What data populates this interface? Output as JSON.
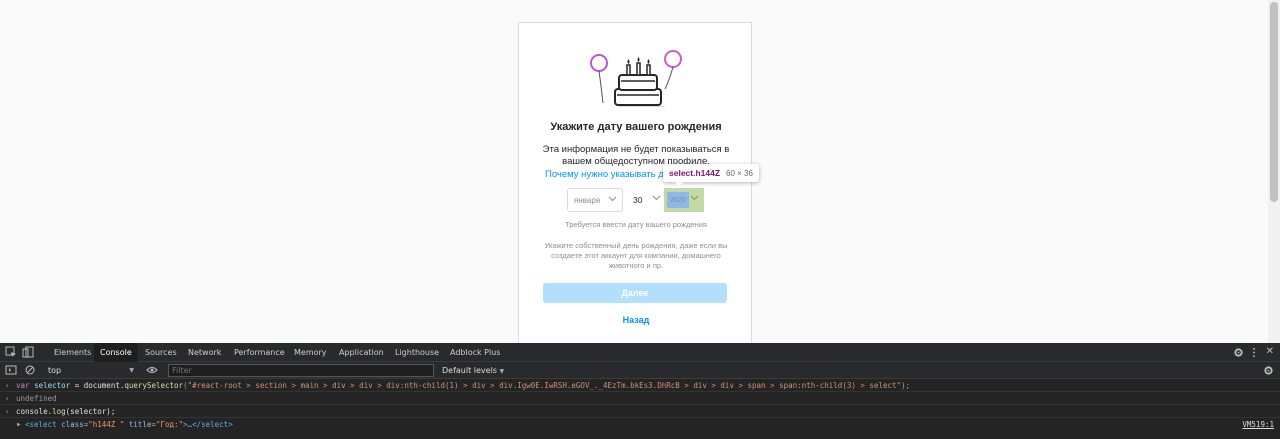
{
  "page": {
    "title": "Укажите дату вашего рождения",
    "info_line1": "Эта информация не будет показываться в",
    "info_line2": "вашем общедоступном профиле.",
    "why_link": "Почему нужно указывать д",
    "month_value": "января",
    "day_value": "30",
    "year_value": "2020",
    "required_text": "Требуется ввести дату вашего рождения",
    "explain_line1": "Укажите собственный день рождения, даже если вы",
    "explain_line2": "создаете этот аккаунт для компании, домашнего",
    "explain_line3": "животного и пр.",
    "next_button": "Далее",
    "back_link": "Назад",
    "inspect_tooltip": {
      "tag": "select.h144Z",
      "size": "60 × 36"
    }
  },
  "devtools": {
    "tabs": [
      "Elements",
      "Console",
      "Sources",
      "Network",
      "Performance",
      "Memory",
      "Application",
      "Lighthouse",
      "Adblock Plus"
    ],
    "active_tab": "Console",
    "context": "top",
    "filter_placeholder": "Filter",
    "levels": "Default levels",
    "console": {
      "line1_kw": "var",
      "line1_var": "selector",
      "line1_eq": " = document.",
      "line1_fn": "querySelector",
      "line1_str": "(\"#react-root > section > main > div > div > div:nth-child(1) > div > div.Igw0E.IwRSH.eGOV_._4EzTm.bkEs3.DhRcB > div > div > span > span:nth-child(3) > select\");",
      "line2": "undefined",
      "line3_a": "console.",
      "line3_fn": "log",
      "line3_b": "(selector);",
      "line4_open": "<select",
      "line4_attr1": "class=",
      "line4_val1": "\"h144Z  \"",
      "line4_attr2": "title=",
      "line4_val2": "\"Год:\"",
      "line4_close": ">…</select>",
      "vm_link": "VM519:1"
    }
  }
}
